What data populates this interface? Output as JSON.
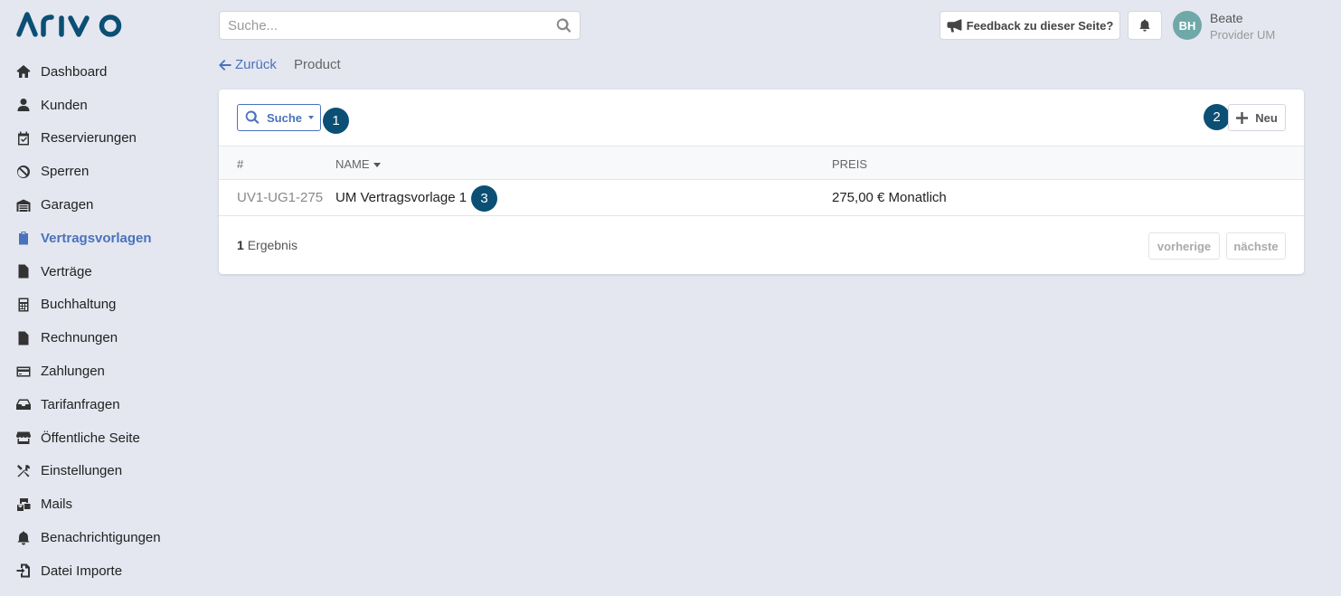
{
  "brand": {
    "logo_text": "ARIVO"
  },
  "sidebar": {
    "items": [
      {
        "label": "Dashboard",
        "icon": "home-icon"
      },
      {
        "label": "Kunden",
        "icon": "user-icon"
      },
      {
        "label": "Reservierungen",
        "icon": "calendar-check-icon"
      },
      {
        "label": "Sperren",
        "icon": "ban-icon"
      },
      {
        "label": "Garagen",
        "icon": "warehouse-icon"
      },
      {
        "label": "Vertragsvorlagen",
        "icon": "clipboard-icon",
        "active": true
      },
      {
        "label": "Verträge",
        "icon": "file-contract-icon"
      },
      {
        "label": "Buchhaltung",
        "icon": "calculator-icon"
      },
      {
        "label": "Rechnungen",
        "icon": "file-invoice-icon"
      },
      {
        "label": "Zahlungen",
        "icon": "credit-card-icon"
      },
      {
        "label": "Tarifanfragen",
        "icon": "inbox-icon"
      },
      {
        "label": "Öffentliche Seite",
        "icon": "store-icon"
      },
      {
        "label": "Einstellungen",
        "icon": "tools-icon"
      },
      {
        "label": "Mails",
        "icon": "mail-bulk-icon"
      },
      {
        "label": "Benachrichtigungen",
        "icon": "bell-icon"
      },
      {
        "label": "Datei Importe",
        "icon": "file-import-icon"
      }
    ]
  },
  "topbar": {
    "search_placeholder": "Suche...",
    "feedback_label": "Feedback zu dieser Seite?",
    "user": {
      "initials": "BH",
      "name": "Beate",
      "role": "Provider UM"
    }
  },
  "breadcrumb": {
    "back_label": "Zurück",
    "current": "Product"
  },
  "card": {
    "search_button_label": "Suche",
    "new_button_label": "Neu",
    "badges": [
      "1",
      "2",
      "3"
    ],
    "columns": [
      "#",
      "NAME",
      "PREIS"
    ],
    "rows": [
      {
        "id": "UV1-UG1-275",
        "name": "UM Vertragsvorlage 1",
        "price": "275,00 € Monatlich"
      }
    ],
    "result_count": "1",
    "result_label": "Ergebnis",
    "prev_label": "vorherige",
    "next_label": "nächste"
  },
  "colors": {
    "accent": "#4a72bc",
    "badge": "#0b4f74",
    "background": "#e4e7f0",
    "avatar": "#6fa8a8"
  }
}
